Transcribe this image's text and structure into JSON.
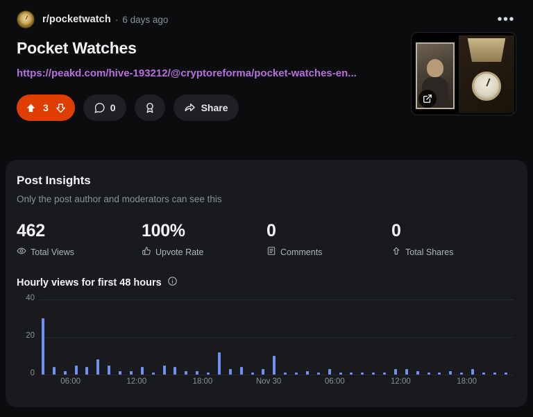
{
  "post": {
    "subreddit": "r/pocketwatch",
    "separator": "·",
    "timestamp": "6 days ago",
    "overflow_label": "•••",
    "title": "Pocket Watches",
    "link_text": "https://peakd.com/hive-193212/@cryptoreforma/pocket-watches-en...",
    "avatar_icon": "pocketwatch-avatar",
    "thumbnail_icon": "pocket-watch-in-case-thumbnail",
    "external_link_icon": "external-link-icon"
  },
  "actions": {
    "upvote_icon": "upvote-arrow-icon",
    "vote_count": "3",
    "downvote_icon": "downvote-arrow-icon",
    "comment_icon": "comment-bubble-icon",
    "comment_count": "0",
    "award_icon": "award-ribbon-icon",
    "share_icon": "share-arrow-icon",
    "share_label": "Share"
  },
  "insights": {
    "title": "Post Insights",
    "subtitle": "Only the post author and moderators can see this",
    "stats": [
      {
        "value": "462",
        "label": "Total Views",
        "icon": "eye-icon"
      },
      {
        "value": "100%",
        "label": "Upvote Rate",
        "icon": "upvote-hand-icon"
      },
      {
        "value": "0",
        "label": "Comments",
        "icon": "comments-list-icon"
      },
      {
        "value": "0",
        "label": "Total Shares",
        "icon": "share-up-icon"
      }
    ],
    "chart_title": "Hourly views for first 48 hours",
    "info_icon": "info-circle-icon"
  },
  "colors": {
    "page_background": "#0b0c0e",
    "card_background": "#181a1d",
    "vote_pill": "#e03d00",
    "bar": "#6f92f0",
    "link": "#b86fe0",
    "grid": "#24272b"
  },
  "chart_data": {
    "type": "bar",
    "title": "Hourly views for first 48 hours",
    "xlabel": "",
    "ylabel": "",
    "ylim": [
      0,
      40
    ],
    "yticks": [
      0,
      20,
      40
    ],
    "grid": true,
    "legend": null,
    "xticks": [
      {
        "label": "06:00",
        "index": 5
      },
      {
        "label": "12:00",
        "index": 17
      },
      {
        "label": "18:00",
        "index": 29
      },
      {
        "label": "Nov 30",
        "index": 41
      },
      {
        "label": "06:00",
        "index": 53
      },
      {
        "label": "12:00",
        "index": 65
      },
      {
        "label": "18:00",
        "index": 77
      }
    ],
    "values": [
      30,
      0,
      4,
      0,
      2,
      0,
      5,
      0,
      4,
      0,
      8,
      0,
      5,
      0,
      2,
      0,
      2,
      0,
      4,
      0,
      1,
      0,
      5,
      0,
      4,
      0,
      2,
      0,
      2,
      0,
      1,
      0,
      12,
      0,
      3,
      0,
      4,
      0,
      1,
      0,
      3,
      0,
      10,
      0,
      1,
      0,
      1,
      0,
      2,
      0,
      1,
      0,
      3,
      0,
      1,
      0,
      1,
      0,
      1,
      0,
      1,
      0,
      1,
      0,
      3,
      0,
      3,
      0,
      2,
      0,
      1,
      0,
      1,
      0,
      2,
      0,
      1,
      0,
      3,
      0,
      1,
      0,
      1,
      0,
      1,
      0
    ]
  }
}
